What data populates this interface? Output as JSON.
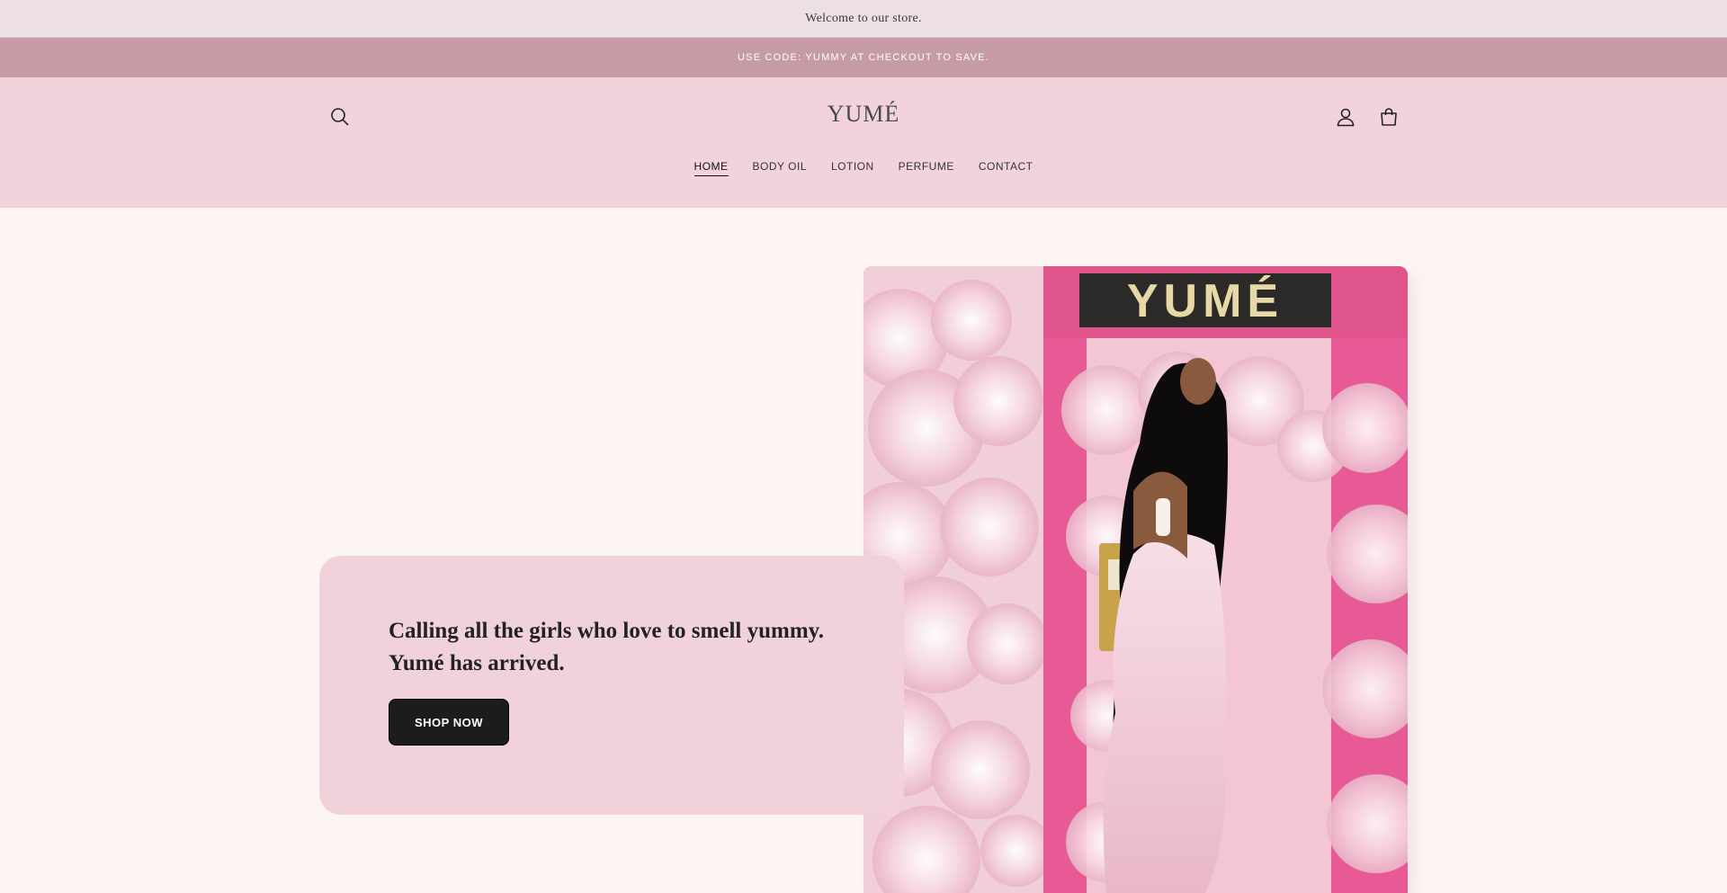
{
  "announcement": {
    "welcome": "Welcome to our store.",
    "promo": "USE CODE: YUMMY AT CHECKOUT TO SAVE."
  },
  "header": {
    "logo": "YUMÉ",
    "nav": [
      "HOME",
      "BODY OIL",
      "LOTION",
      "PERFUME",
      "CONTACT"
    ],
    "active_nav": "HOME",
    "icons": {
      "search": "search-icon",
      "account": "account-icon",
      "cart": "cart-icon"
    }
  },
  "hero": {
    "headline": "Calling all the girls who love to smell yummy. Yumé has arrived.",
    "button_label": "SHOP NOW",
    "sign_text": "YUMÉ"
  },
  "colors": {
    "announcement_bg": "#ede0e5",
    "promo_bg": "#c79ba6",
    "header_bg": "#f2d3dc",
    "card_bg": "#f1d2db",
    "button_bg": "#1c1c1c",
    "accent_pink": "#e85a95"
  }
}
